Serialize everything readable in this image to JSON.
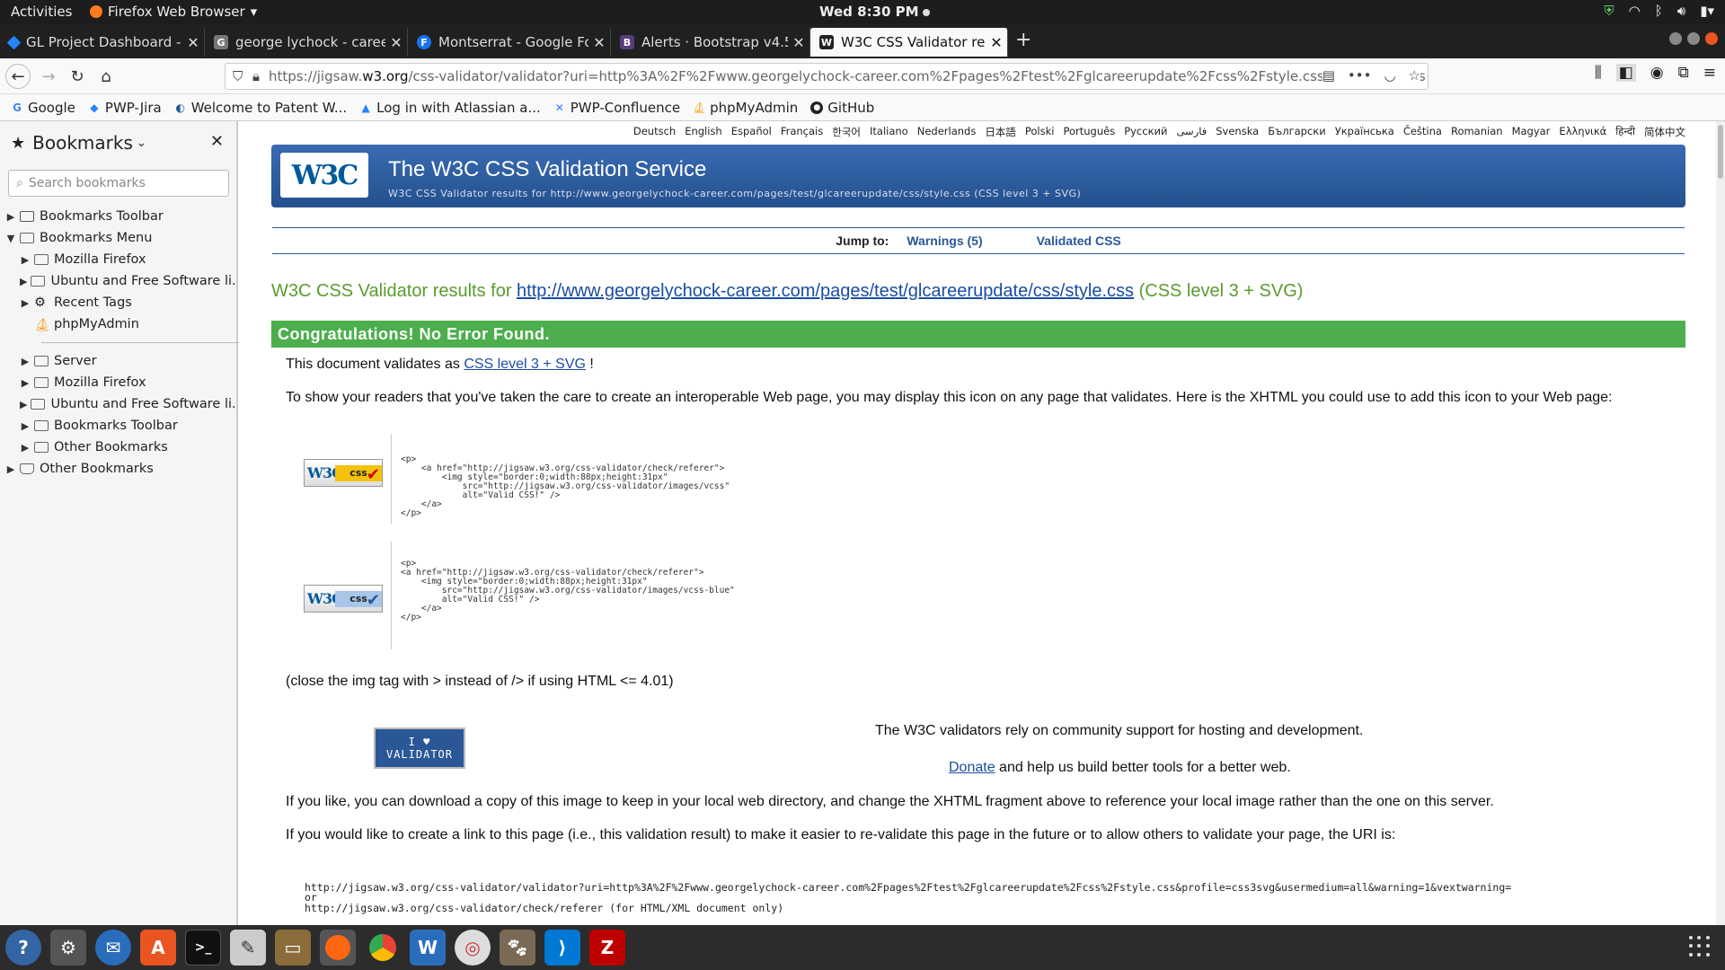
{
  "topbar": {
    "activities": "Activities",
    "app_name": "Firefox Web Browser",
    "clock": "Wed  8:30 PM"
  },
  "tabs": [
    {
      "label": "GL Project Dashboard - P",
      "icon_color": "#2684ff",
      "icon": "diamond-icon"
    },
    {
      "label": "george lychock - career",
      "icon_color": "#777777",
      "icon": "gl-icon"
    },
    {
      "label": "Montserrat - Google Fon",
      "icon_color": "#1a73e8",
      "icon": "fonts-icon"
    },
    {
      "label": "Alerts · Bootstrap v4.5",
      "icon_color": "#563d7c",
      "icon": "bootstrap-icon"
    },
    {
      "label": "W3C CSS Validator resul",
      "icon_color": "#222222",
      "icon": "w3c-icon"
    }
  ],
  "url": {
    "prefix": "https://jigsaw.",
    "host": "w3.org",
    "rest": "/css-validator/validator?uri=http%3A%2F%2Fwww.georgelychock-career.com%2Fpages%2Ftest%2Fglcareerupdate%2Fcss%2Fstyle.css&profile=css3s"
  },
  "bookmarks_bar": [
    {
      "label": "Google",
      "icon": "google-icon"
    },
    {
      "label": "PWP-Jira",
      "icon": "jira-icon"
    },
    {
      "label": "Welcome to Patent W...",
      "icon": "patent-icon"
    },
    {
      "label": "Log in with Atlassian a...",
      "icon": "atlassian-icon"
    },
    {
      "label": "PWP-Confluence",
      "icon": "confluence-icon"
    },
    {
      "label": "phpMyAdmin",
      "icon": "phpmyadmin-icon"
    },
    {
      "label": "GitHub",
      "icon": "github-icon"
    }
  ],
  "sidebar": {
    "title": "Bookmarks",
    "search_placeholder": "Search bookmarks",
    "tree_top": [
      {
        "label": "Bookmarks Toolbar",
        "level": 0,
        "state": "collapsed"
      },
      {
        "label": "Bookmarks Menu",
        "level": 0,
        "state": "expanded"
      },
      {
        "label": "Mozilla Firefox",
        "level": 1,
        "state": "collapsed"
      },
      {
        "label": "Ubuntu and Free Software li...",
        "level": 1,
        "state": "collapsed"
      },
      {
        "label": "Recent Tags",
        "level": 1,
        "state": "collapsed"
      },
      {
        "label": "phpMyAdmin",
        "level": 1,
        "state": "leaf"
      }
    ],
    "tree_bottom": [
      {
        "label": "Server",
        "level": 1,
        "state": "collapsed"
      },
      {
        "label": "Mozilla Firefox",
        "level": 1,
        "state": "collapsed"
      },
      {
        "label": "Ubuntu and Free Software li...",
        "level": 1,
        "state": "collapsed"
      },
      {
        "label": "Bookmarks Toolbar",
        "level": 1,
        "state": "collapsed"
      },
      {
        "label": "Other Bookmarks",
        "level": 1,
        "state": "collapsed"
      },
      {
        "label": "Other Bookmarks",
        "level": 0,
        "state": "collapsed"
      }
    ]
  },
  "page": {
    "languages": [
      "Deutsch",
      "English",
      "Español",
      "Français",
      "한국어",
      "Italiano",
      "Nederlands",
      "日本語",
      "Polski",
      "Português",
      "Русский",
      "فارسی",
      "Svenska",
      "Български",
      "Українська",
      "Čeština",
      "Romanian",
      "Magyar",
      "Ελληνικά",
      "हिन्दी",
      "简体中文"
    ],
    "banner_title": "The W3C CSS Validation Service",
    "banner_sub": "W3C CSS Validator results for http://www.georgelychock-career.com/pages/test/glcareerupdate/css/style.css (CSS level 3 + SVG)",
    "logo_text": "W3C",
    "jump_label": "Jump to:",
    "jump_warnings": "Warnings (5)",
    "jump_validated": "Validated CSS",
    "result_prefix": "W3C CSS Validator results for ",
    "result_link": "http://www.georgelychock-career.com/pages/test/glcareerupdate/css/style.css",
    "result_suffix": " (CSS level 3 + SVG)",
    "congrats": "Congratulations! No Error Found.",
    "validates_prefix": "This document validates as ",
    "validates_link": "CSS level 3 + SVG",
    "validates_suffix": " !",
    "icon_text": "To show your readers that you've taken the care to create an interoperable Web page, you may display this icon on any page that validates. Here is the XHTML you could use to add this icon to your Web page:",
    "badge_w3c": "W3C",
    "badge_css": "css",
    "code1": "<p>\n    <a href=\"http://jigsaw.w3.org/css-validator/check/referer\">\n        <img style=\"border:0;width:88px;height:31px\"\n            src=\"http://jigsaw.w3.org/css-validator/images/vcss\"\n            alt=\"Valid CSS!\" />\n    </a>\n</p>",
    "code2": "<p>\n<a href=\"http://jigsaw.w3.org/css-validator/check/referer\">\n    <img style=\"border:0;width:88px;height:31px\"\n        src=\"http://jigsaw.w3.org/css-validator/images/vcss-blue\"\n        alt=\"Valid CSS!\" />\n    </a>\n</p>",
    "close_tag_note": "(close the img tag with > instead of /> if using HTML <= 4.01)",
    "validator_btn_line1": "I ♥",
    "validator_btn_line2": "VALIDATOR",
    "community": "The W3C validators rely on community support for hosting and development.",
    "donate_link": "Donate",
    "donate_suffix": " and help us build better tools for a better web.",
    "download_text": "If you like, you can download a copy of this image to keep in your local web directory, and change the XHTML fragment above to reference your local image rather than the one on this server.",
    "link_text": "If you would like to create a link to this page (i.e., this validation result) to make it easier to re-validate this page in the future or to allow others to validate your page, the URI is:",
    "uri1": "http://jigsaw.w3.org/css-validator/validator?uri=http%3A%2F%2Fwww.georgelychock-career.com%2Fpages%2Ftest%2Fglcareerupdate%2Fcss%2Fstyle.css&profile=css3svg&usermedium=all&warning=1&vextwarning=",
    "uri_or": "or",
    "uri2": "http://jigsaw.w3.org/css-validator/check/referer (for HTML/XML document only)"
  },
  "colors": {
    "banner": "#2b5797",
    "congrats": "#4cae4c",
    "result_heading": "#5a9c2f",
    "link": "#1a4da0"
  },
  "dock": [
    {
      "icon": "help-icon",
      "color": "#3465a4"
    },
    {
      "icon": "settings-icon",
      "color": "#555555"
    },
    {
      "icon": "thunderbird-icon",
      "color": "#2a6ebb"
    },
    {
      "icon": "software-center-icon",
      "color": "#e95420"
    },
    {
      "icon": "terminal-icon",
      "color": "#111111"
    },
    {
      "icon": "text-editor-icon",
      "color": "#cccccc"
    },
    {
      "icon": "files-icon",
      "color": "#8a6d3b"
    },
    {
      "icon": "firefox-icon",
      "color": "#ff6611"
    },
    {
      "icon": "chrome-icon",
      "color": "#34a853"
    },
    {
      "icon": "writer-icon",
      "color": "#2a6ebb"
    },
    {
      "icon": "disk-icon",
      "color": "#cc3333"
    },
    {
      "icon": "gimp-icon",
      "color": "#7a6a55"
    },
    {
      "icon": "vscode-icon",
      "color": "#0078d4"
    },
    {
      "icon": "filezilla-icon",
      "color": "#bf0000"
    }
  ]
}
